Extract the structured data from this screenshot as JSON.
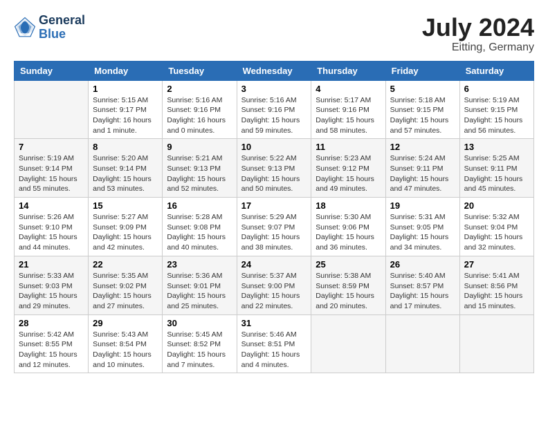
{
  "header": {
    "logo_line1": "General",
    "logo_line2": "Blue",
    "month_year": "July 2024",
    "location": "Eitting, Germany"
  },
  "days_of_week": [
    "Sunday",
    "Monday",
    "Tuesday",
    "Wednesday",
    "Thursday",
    "Friday",
    "Saturday"
  ],
  "weeks": [
    [
      {
        "day": "",
        "info": ""
      },
      {
        "day": "1",
        "info": "Sunrise: 5:15 AM\nSunset: 9:17 PM\nDaylight: 16 hours\nand 1 minute."
      },
      {
        "day": "2",
        "info": "Sunrise: 5:16 AM\nSunset: 9:16 PM\nDaylight: 16 hours\nand 0 minutes."
      },
      {
        "day": "3",
        "info": "Sunrise: 5:16 AM\nSunset: 9:16 PM\nDaylight: 15 hours\nand 59 minutes."
      },
      {
        "day": "4",
        "info": "Sunrise: 5:17 AM\nSunset: 9:16 PM\nDaylight: 15 hours\nand 58 minutes."
      },
      {
        "day": "5",
        "info": "Sunrise: 5:18 AM\nSunset: 9:15 PM\nDaylight: 15 hours\nand 57 minutes."
      },
      {
        "day": "6",
        "info": "Sunrise: 5:19 AM\nSunset: 9:15 PM\nDaylight: 15 hours\nand 56 minutes."
      }
    ],
    [
      {
        "day": "7",
        "info": "Sunrise: 5:19 AM\nSunset: 9:14 PM\nDaylight: 15 hours\nand 55 minutes."
      },
      {
        "day": "8",
        "info": "Sunrise: 5:20 AM\nSunset: 9:14 PM\nDaylight: 15 hours\nand 53 minutes."
      },
      {
        "day": "9",
        "info": "Sunrise: 5:21 AM\nSunset: 9:13 PM\nDaylight: 15 hours\nand 52 minutes."
      },
      {
        "day": "10",
        "info": "Sunrise: 5:22 AM\nSunset: 9:13 PM\nDaylight: 15 hours\nand 50 minutes."
      },
      {
        "day": "11",
        "info": "Sunrise: 5:23 AM\nSunset: 9:12 PM\nDaylight: 15 hours\nand 49 minutes."
      },
      {
        "day": "12",
        "info": "Sunrise: 5:24 AM\nSunset: 9:11 PM\nDaylight: 15 hours\nand 47 minutes."
      },
      {
        "day": "13",
        "info": "Sunrise: 5:25 AM\nSunset: 9:11 PM\nDaylight: 15 hours\nand 45 minutes."
      }
    ],
    [
      {
        "day": "14",
        "info": "Sunrise: 5:26 AM\nSunset: 9:10 PM\nDaylight: 15 hours\nand 44 minutes."
      },
      {
        "day": "15",
        "info": "Sunrise: 5:27 AM\nSunset: 9:09 PM\nDaylight: 15 hours\nand 42 minutes."
      },
      {
        "day": "16",
        "info": "Sunrise: 5:28 AM\nSunset: 9:08 PM\nDaylight: 15 hours\nand 40 minutes."
      },
      {
        "day": "17",
        "info": "Sunrise: 5:29 AM\nSunset: 9:07 PM\nDaylight: 15 hours\nand 38 minutes."
      },
      {
        "day": "18",
        "info": "Sunrise: 5:30 AM\nSunset: 9:06 PM\nDaylight: 15 hours\nand 36 minutes."
      },
      {
        "day": "19",
        "info": "Sunrise: 5:31 AM\nSunset: 9:05 PM\nDaylight: 15 hours\nand 34 minutes."
      },
      {
        "day": "20",
        "info": "Sunrise: 5:32 AM\nSunset: 9:04 PM\nDaylight: 15 hours\nand 32 minutes."
      }
    ],
    [
      {
        "day": "21",
        "info": "Sunrise: 5:33 AM\nSunset: 9:03 PM\nDaylight: 15 hours\nand 29 minutes."
      },
      {
        "day": "22",
        "info": "Sunrise: 5:35 AM\nSunset: 9:02 PM\nDaylight: 15 hours\nand 27 minutes."
      },
      {
        "day": "23",
        "info": "Sunrise: 5:36 AM\nSunset: 9:01 PM\nDaylight: 15 hours\nand 25 minutes."
      },
      {
        "day": "24",
        "info": "Sunrise: 5:37 AM\nSunset: 9:00 PM\nDaylight: 15 hours\nand 22 minutes."
      },
      {
        "day": "25",
        "info": "Sunrise: 5:38 AM\nSunset: 8:59 PM\nDaylight: 15 hours\nand 20 minutes."
      },
      {
        "day": "26",
        "info": "Sunrise: 5:40 AM\nSunset: 8:57 PM\nDaylight: 15 hours\nand 17 minutes."
      },
      {
        "day": "27",
        "info": "Sunrise: 5:41 AM\nSunset: 8:56 PM\nDaylight: 15 hours\nand 15 minutes."
      }
    ],
    [
      {
        "day": "28",
        "info": "Sunrise: 5:42 AM\nSunset: 8:55 PM\nDaylight: 15 hours\nand 12 minutes."
      },
      {
        "day": "29",
        "info": "Sunrise: 5:43 AM\nSunset: 8:54 PM\nDaylight: 15 hours\nand 10 minutes."
      },
      {
        "day": "30",
        "info": "Sunrise: 5:45 AM\nSunset: 8:52 PM\nDaylight: 15 hours\nand 7 minutes."
      },
      {
        "day": "31",
        "info": "Sunrise: 5:46 AM\nSunset: 8:51 PM\nDaylight: 15 hours\nand 4 minutes."
      },
      {
        "day": "",
        "info": ""
      },
      {
        "day": "",
        "info": ""
      },
      {
        "day": "",
        "info": ""
      }
    ]
  ]
}
